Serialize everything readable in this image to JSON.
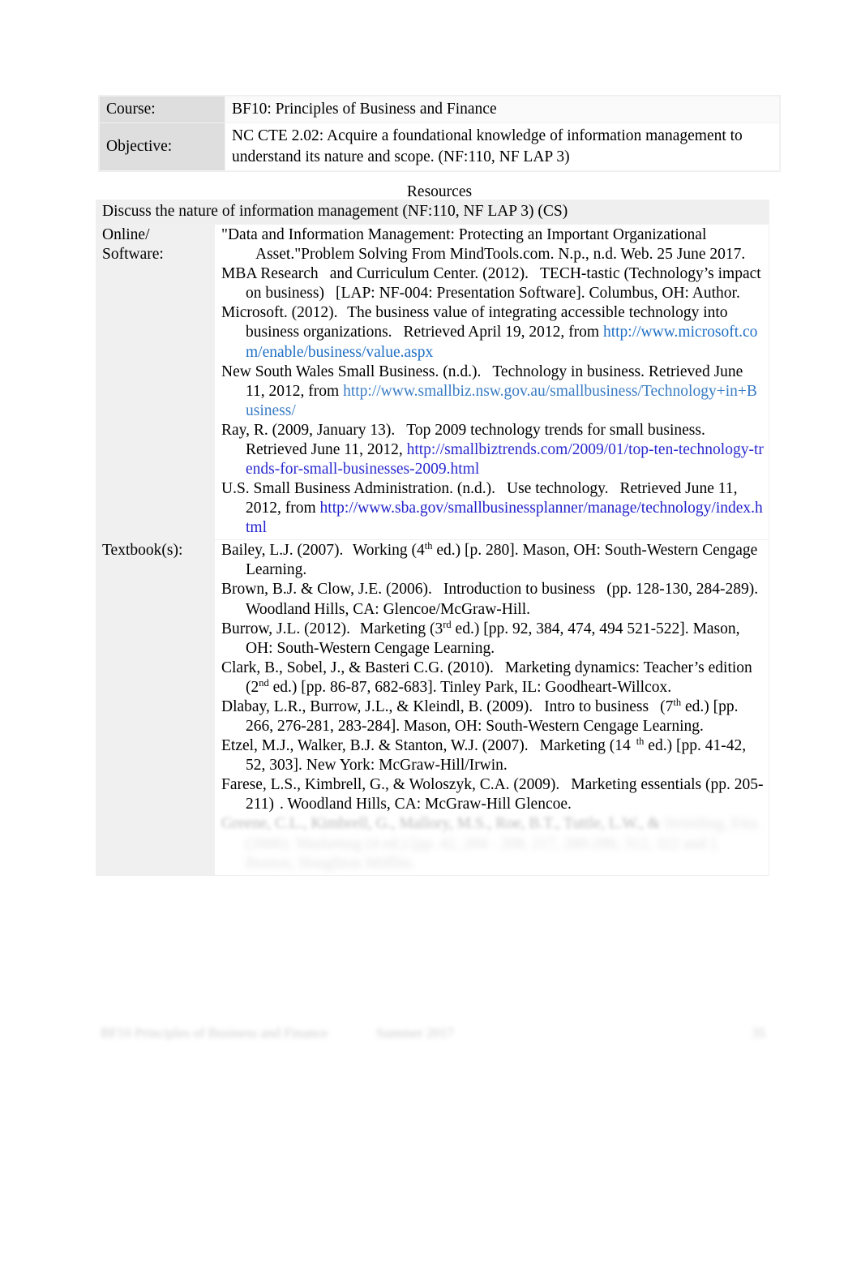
{
  "document": {
    "header": {
      "rows": [
        {
          "label": "Course:",
          "value": "BF10: Principles of Business and Finance"
        },
        {
          "label": "Objective:",
          "value": "NC CTE 2.02: Acquire a foundational knowledge of information management to understand its nature and scope. (NF:110, NF LAP 3)"
        }
      ]
    },
    "resources_caption": "Resources",
    "banner": "Discuss the nature of information management (NF:110, NF LAP 3) (CS)",
    "sections": [
      {
        "label": "Online/ Software:",
        "label_line1": "Online/",
        "label_line2": "Software:"
      },
      {
        "label": "Textbook(s):"
      }
    ],
    "online_citations": [
      {
        "id": "mindtools",
        "line1": "\"Data and Information Management: Protecting an Important",
        "line2": "Organizational Asset.\"Problem Solving From MindTools.com. N.p.,",
        "line3": "n.d. Web. 25 June 2017."
      },
      {
        "id": "mba-research",
        "part1": "MBA Research",
        "part2": "and Curriculum Center. (2012).",
        "part3": "TECH-tastic",
        "part4": "(Technology’s impact on business)",
        "part5": "[LAP: NF-004: Presentation",
        "part6": "Software]. Columbus, OH: Author."
      },
      {
        "id": "microsoft",
        "part1": "Microsoft. (2012).",
        "part2": "The business value of integrating accessible",
        "part3": "technology into business organizations.",
        "part4": "Retrieved April 19, 2012,",
        "part5": "from",
        "url": "http://www.microsoft.com/enable/business/value.aspx",
        "url_color": "#1f6fc4"
      },
      {
        "id": "nsw-small-business",
        "part1": "New South Wales Small Business. (n.d.).",
        "part2": "Technology in business.",
        "part3": "Retrieved June 11, 2012, from",
        "url": "http://www.smallbiz.nsw.gov.au/smallbusiness/Technology+in+Business/",
        "url_color": "#3a7cc4"
      },
      {
        "id": "ray-2009",
        "part1": "Ray, R. (2009, January 13).",
        "part2": "Top 2009 technology trends for small",
        "part3": "business.",
        "part4": "Retrieved June 11, 2012,",
        "url": "http://smallbiztrends.com/2009/01/top-ten-technology-trends-for-small-businesses-2009.html",
        "url_color": "#2a2ad0"
      },
      {
        "id": "sba",
        "part1": "U.S. Small Business Administration. (n.d.).",
        "part2": "Use technology.",
        "part3": "Retrieved",
        "part4": "June 11, 2012, from",
        "url": "http://www.sba.gov/smallbusinessplanner/manage/technology/index.html",
        "url_color": "#2222cc"
      }
    ],
    "textbook_citations": [
      {
        "id": "bailey",
        "part1": "Bailey, L.J. (2007).",
        "part2": "Working",
        "edition_num": "4",
        "edition_sup": "th",
        "part3": "ed.) [p. 280]. Mason, OH: South-Western",
        "part4": "Cengage Learning."
      },
      {
        "id": "brown-clow",
        "part1": "Brown, B.J. & Clow, J.E. (2006).",
        "part2": "Introduction to business",
        "part3": "(pp. 128-130,",
        "part4": "284-289). Woodland Hills, CA: Glencoe/McGraw-Hill."
      },
      {
        "id": "burrow",
        "part1": "Burrow, J.L. (2012).",
        "part2": "Marketing",
        "edition_num": "3",
        "edition_sup": "rd",
        "part3": "ed.) [pp. 92, 384, 474, 494 521-522].",
        "part4": "Mason, OH: South-Western Cengage Learning."
      },
      {
        "id": "clark-sobel-basteri",
        "part1": "Clark, B., Sobel, J., & Basteri C.G. (2010).",
        "part2": "Marketing dynamics:",
        "part3": "Teacher’s edition",
        "edition_num": "2",
        "edition_sup": "nd",
        "part4": "ed.) [pp. 86-87, 682-683]. Tinley Park, IL:",
        "part5": "Goodheart-Willcox."
      },
      {
        "id": "dlabay-burrow-kleindl",
        "part1": "Dlabay, L.R., Burrow, J.L., & Kleindl, B. (2009).",
        "part2": "Intro to business",
        "edition_num": "7",
        "edition_sup": "th",
        "part3": "ed.)",
        "part4": "[pp. 266, 276-281, 283-284]. Mason, OH: South-Western Cengage",
        "part5": "Learning."
      },
      {
        "id": "etzel-walker-stanton",
        "part1": "Etzel, M.J., Walker, B.J. & Stanton, W.J. (2007).",
        "part2": "Marketing",
        "edition_num": "14",
        "edition_sup": "th",
        "part3": "ed.)",
        "part4": "[pp. 41-42, 52, 303]. New York: McGraw-Hill/Irwin."
      },
      {
        "id": "farese-kimbrell-woloszyk",
        "part1": "Farese, L.S., Kimbrell, G., & Woloszyk, C.A. (2009).",
        "part2": "Marketing essentials",
        "part3": "(pp. 205-211)",
        "part4": ". Woodland Hills, CA: McGraw-Hill Glencoe."
      }
    ],
    "obscured_citations": [
      {
        "id": "obscured-1",
        "line1": "Greene, C.L., Kimbrell, G., Mallory, M.S., Roe, B.T., Tuttle, L.W., &",
        "line2": "Strimling, Etta. (2006).   Marketing  (4  ed.) [pp. 42, 204 - 208,",
        "line3": "217, 280-286, 312, 322 and ]. Boston, Houghton Mifflin."
      }
    ],
    "footer": {
      "left": "BF10 Principles of Business and Finance",
      "middle": "Summer 2017",
      "right": "35"
    }
  }
}
